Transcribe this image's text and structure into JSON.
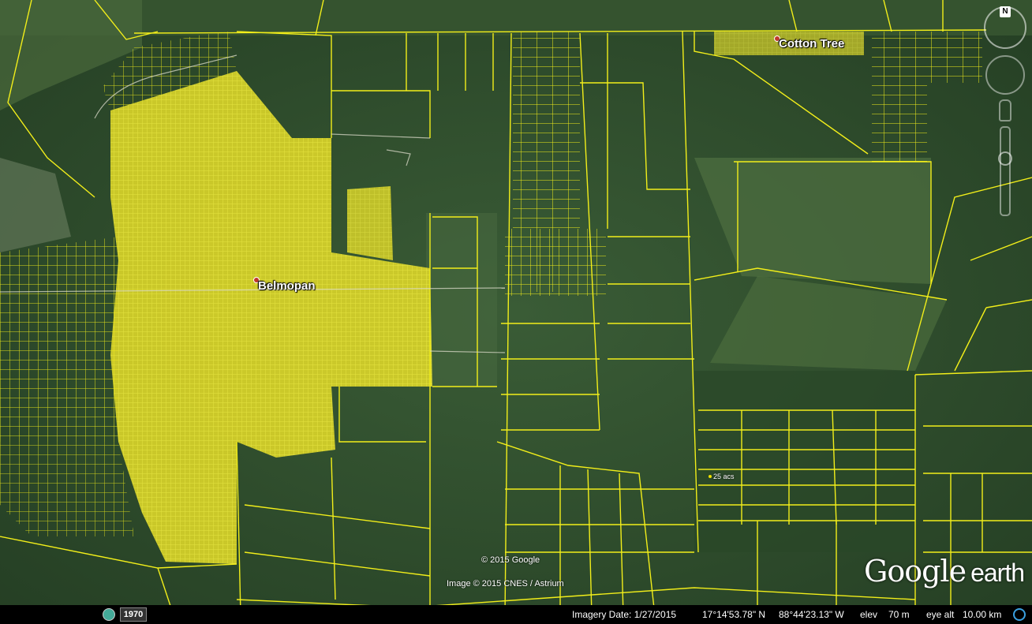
{
  "places": {
    "belmopan": "Belmopan",
    "cotton_tree": "Cotton Tree",
    "parcel_label": "25 acs"
  },
  "attribution": {
    "copyright": "© 2015 Google",
    "imagery": "Image © 2015 CNES / Astrium"
  },
  "logo": {
    "word1": "Google",
    "word2": "earth"
  },
  "nav": {
    "north": "N"
  },
  "statusbar": {
    "historical_year": "1970",
    "imagery_date": "Imagery Date: 1/27/2015",
    "lat": "17°14'53.78\" N",
    "lon": "88°44'23.13\" W",
    "elev_label": "elev",
    "elev_value": "70 m",
    "eye_alt_label": "eye alt",
    "eye_alt_value": "10.00 km"
  },
  "colors": {
    "parcel_line": "#f2ee1a",
    "urban_fill": "#e8e23a",
    "forest": "#2f4f2c"
  }
}
